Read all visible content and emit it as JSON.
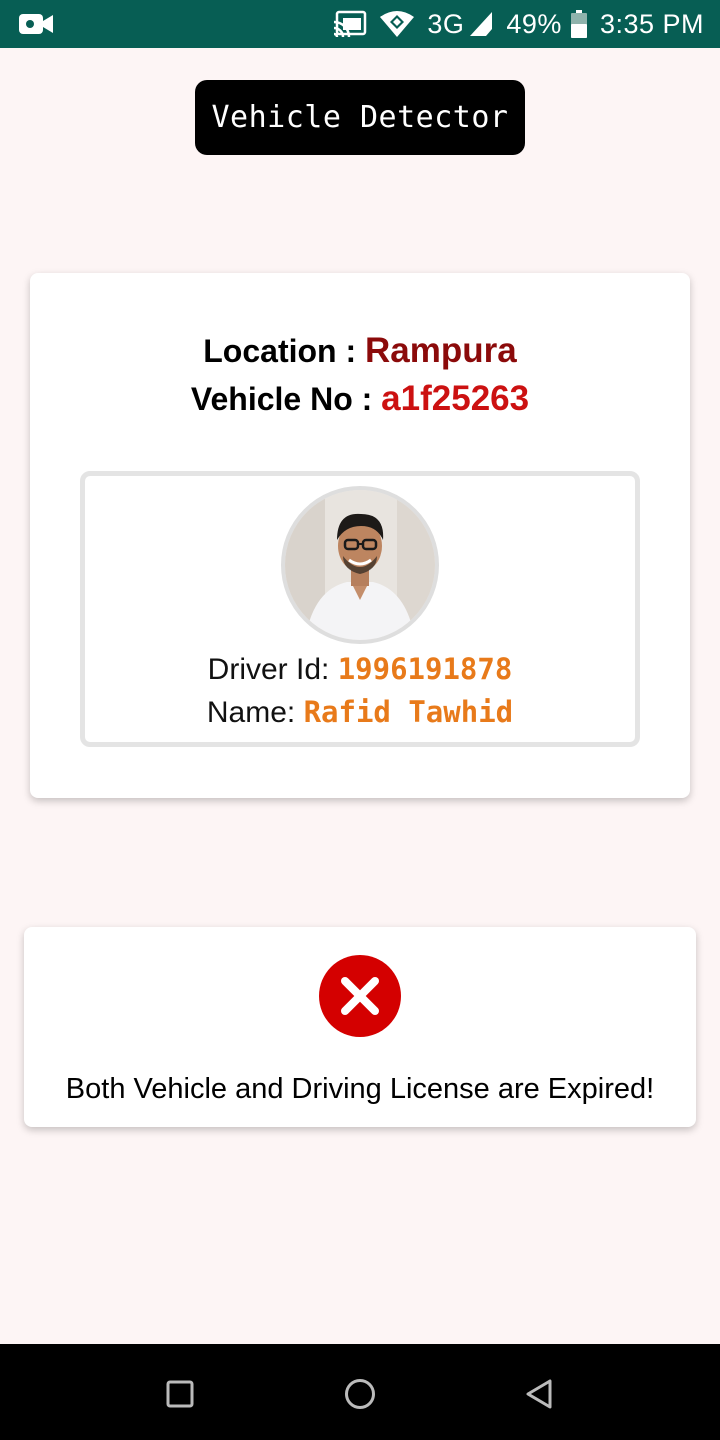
{
  "status_bar": {
    "left_icon": "video-camera-icon",
    "icons": [
      "cast-icon",
      "wifi-icon",
      "signal-icon",
      "battery-icon"
    ],
    "network": "3G",
    "battery": "49%",
    "time": "3:35 PM",
    "bg_color": "#075e54"
  },
  "app": {
    "title": "Vehicle Detector"
  },
  "detection": {
    "location_label": "Location : ",
    "location_value": "Rampura",
    "vehicle_label": "Vehicle No : ",
    "vehicle_value": "a1f25263"
  },
  "driver": {
    "photo": "driver-photo",
    "id_label": "Driver Id: ",
    "id_value": "1996191878",
    "name_label": "Name: ",
    "name_value": "Rafid Tawhid"
  },
  "status": {
    "icon": "error-x-icon",
    "message": "Both Vehicle and Driving License are Expired!",
    "color": "#d40000"
  },
  "nav_bar": {
    "icons": [
      "recent-apps-icon",
      "home-icon",
      "back-icon"
    ]
  },
  "colors": {
    "location_value": "#8b0a0a",
    "vehicle_value": "#cc1111",
    "driver_values": "#e87a1a",
    "page_bg": "#fdf5f5"
  }
}
